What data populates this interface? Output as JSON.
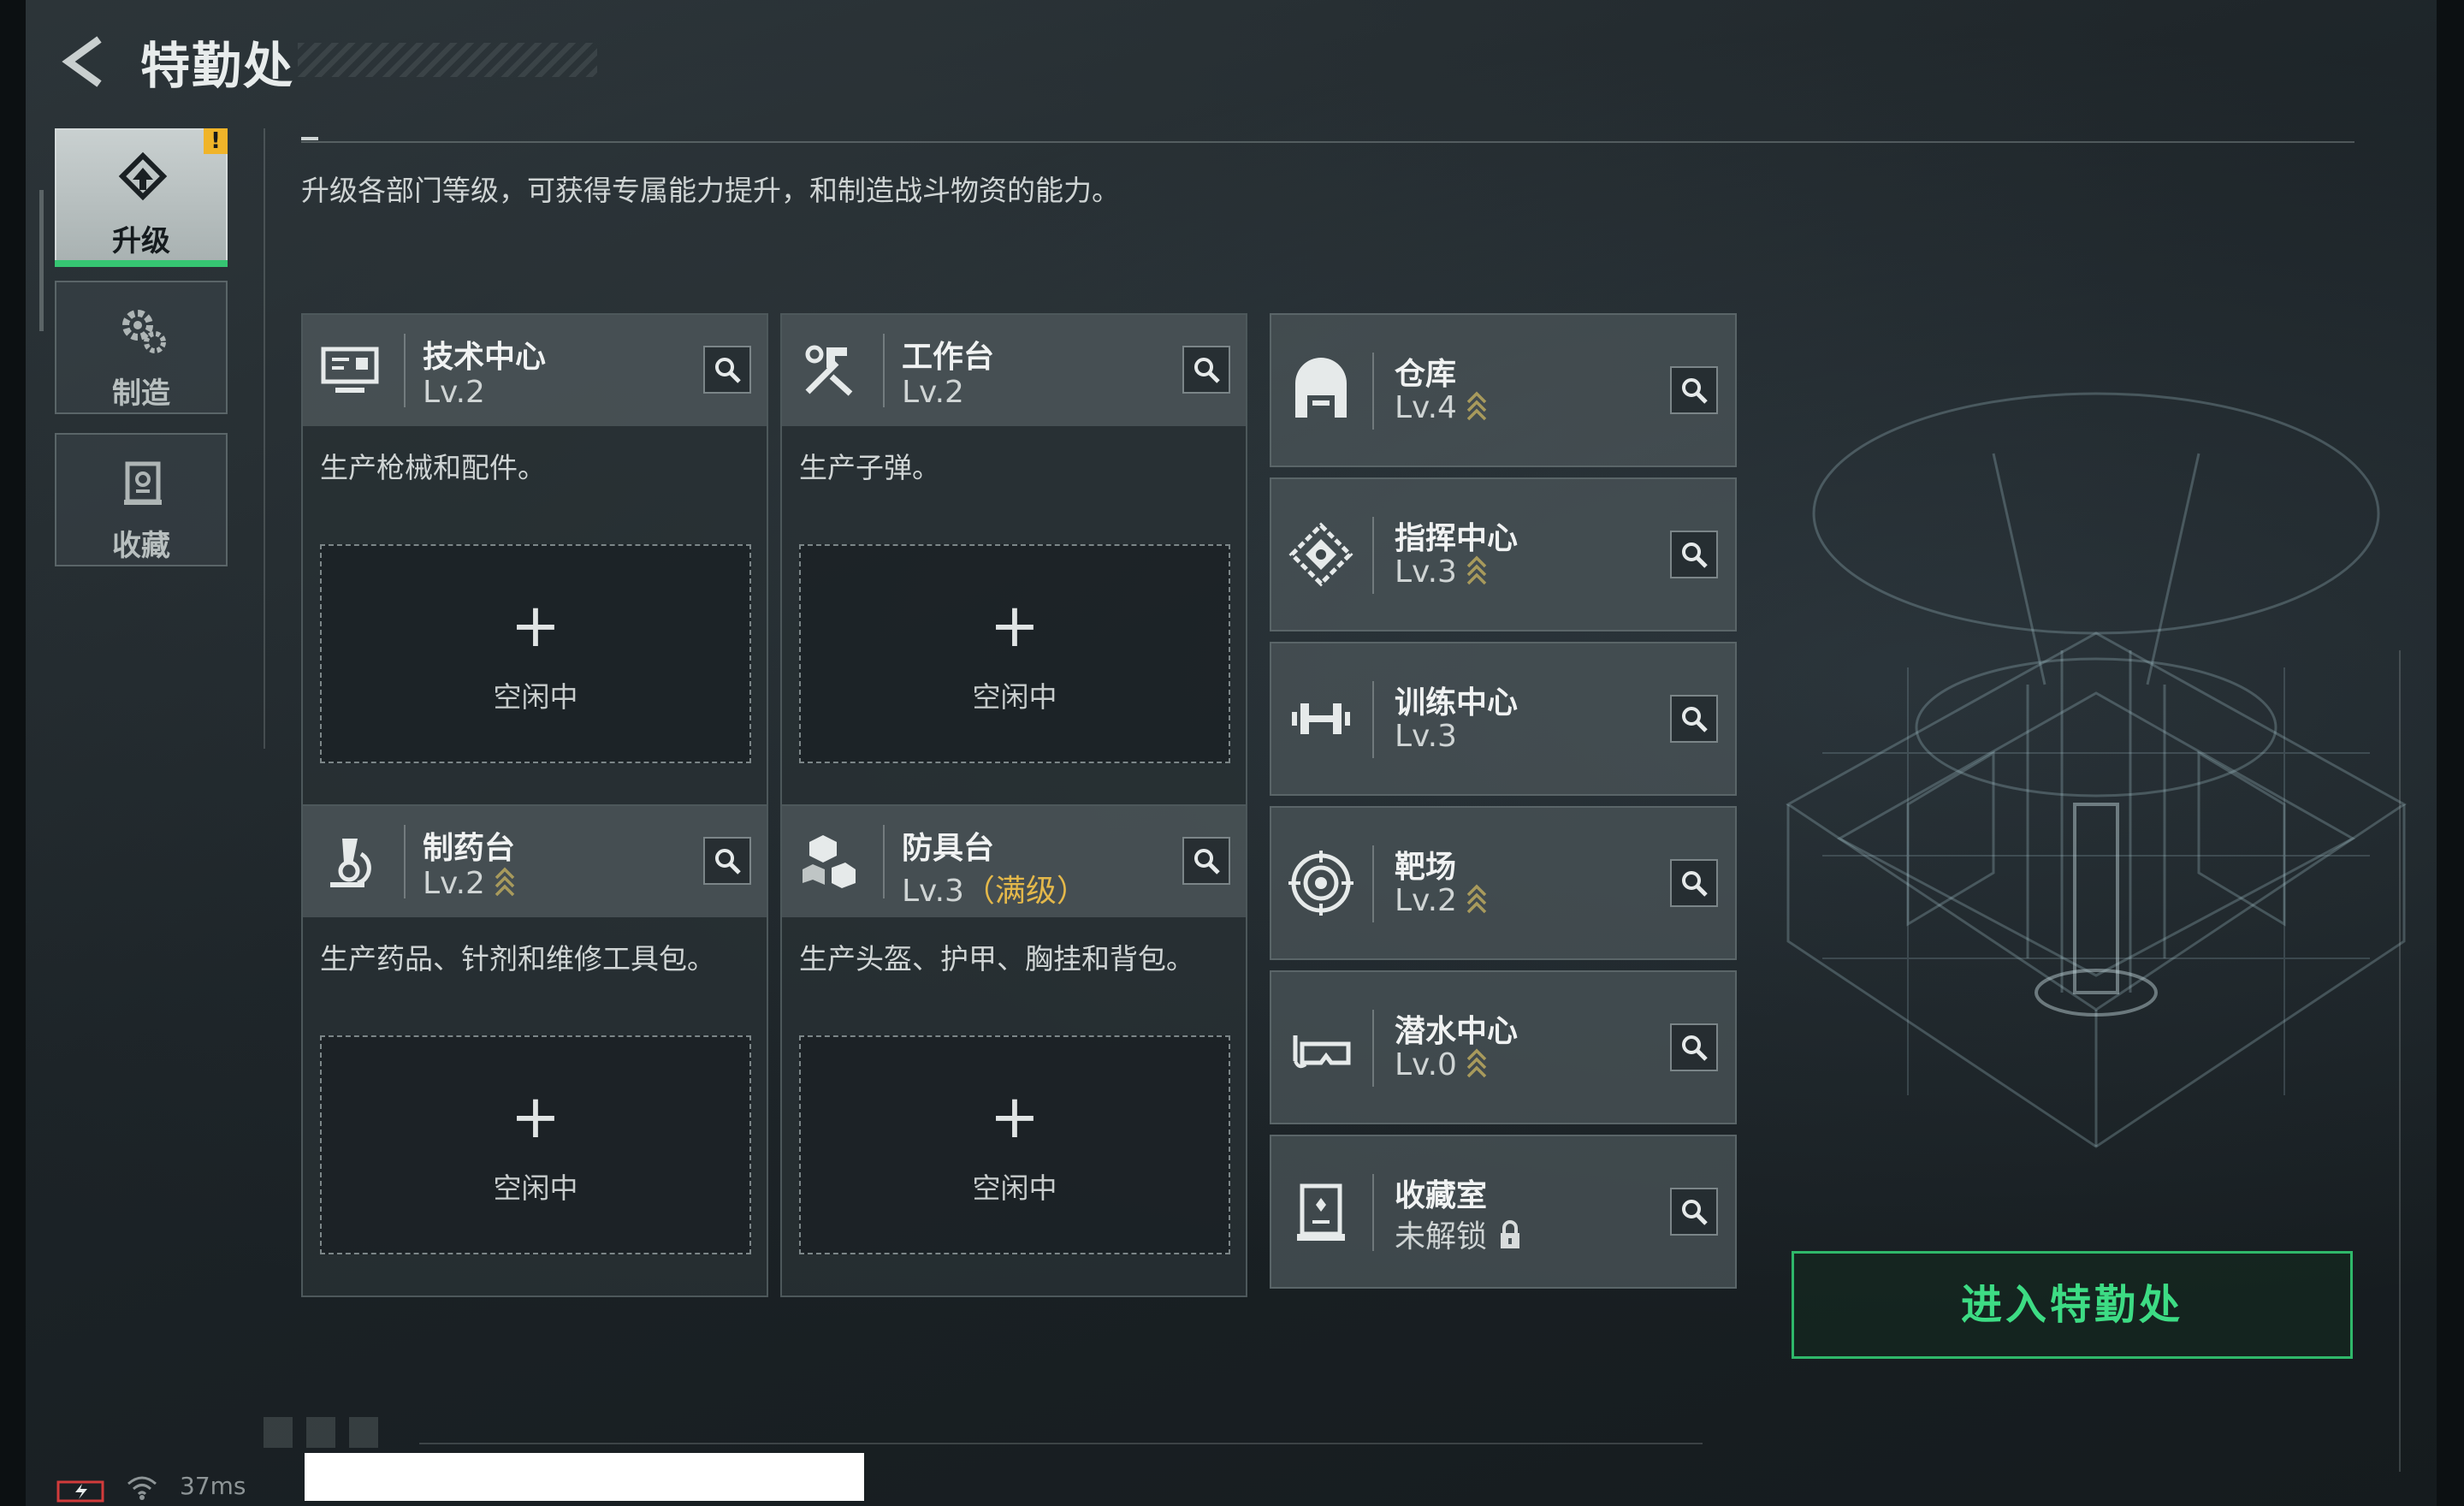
{
  "header": {
    "title": "特勤处",
    "description": "升级各部门等级，可获得专属能力提升，和制造战斗物资的能力。"
  },
  "sidebar": {
    "tabs": [
      {
        "label": "升级",
        "icon": "upgrade-icon",
        "active": true,
        "alert": "!"
      },
      {
        "label": "制造",
        "icon": "gear-icon",
        "active": false
      },
      {
        "label": "收藏",
        "icon": "collection-icon",
        "active": false
      }
    ]
  },
  "production": [
    {
      "name": "技术中心",
      "level": "Lv.2",
      "description": "生产枪械和配件。",
      "slot_status": "空闲中",
      "icon": "computer-icon",
      "upgradeable": false
    },
    {
      "name": "工作台",
      "level": "Lv.2",
      "description": "生产子弹。",
      "slot_status": "空闲中",
      "icon": "tools-icon",
      "upgradeable": false
    },
    {
      "name": "制药台",
      "level": "Lv.2",
      "description": "生产药品、针剂和维修工具包。",
      "slot_status": "空闲中",
      "icon": "microscope-icon",
      "upgradeable": true
    },
    {
      "name": "防具台",
      "level": "Lv.3",
      "max_label": "（满级）",
      "description": "生产头盔、护甲、胸挂和背包。",
      "slot_status": "空闲中",
      "icon": "armor-icon",
      "upgradeable": false
    }
  ],
  "slot_plus": "+",
  "departments": [
    {
      "name": "仓库",
      "level": "Lv.4",
      "icon": "warehouse-icon",
      "upgradeable": true
    },
    {
      "name": "指挥中心",
      "level": "Lv.3",
      "icon": "command-icon",
      "upgradeable": true
    },
    {
      "name": "训练中心",
      "level": "Lv.3",
      "icon": "dumbbell-icon",
      "upgradeable": false
    },
    {
      "name": "靶场",
      "level": "Lv.2",
      "icon": "target-icon",
      "upgradeable": true
    },
    {
      "name": "潜水中心",
      "level": "Lv.0",
      "icon": "diving-mask-icon",
      "upgradeable": true
    },
    {
      "name": "收藏室",
      "level": "未解锁",
      "icon": "vault-icon",
      "locked": true
    }
  ],
  "enter_button": "进入特勤处",
  "status": {
    "ping": "37ms"
  },
  "colors": {
    "accent_green": "#36c572",
    "max_gold": "#e4b84a",
    "alert_yellow": "#f0b429"
  }
}
